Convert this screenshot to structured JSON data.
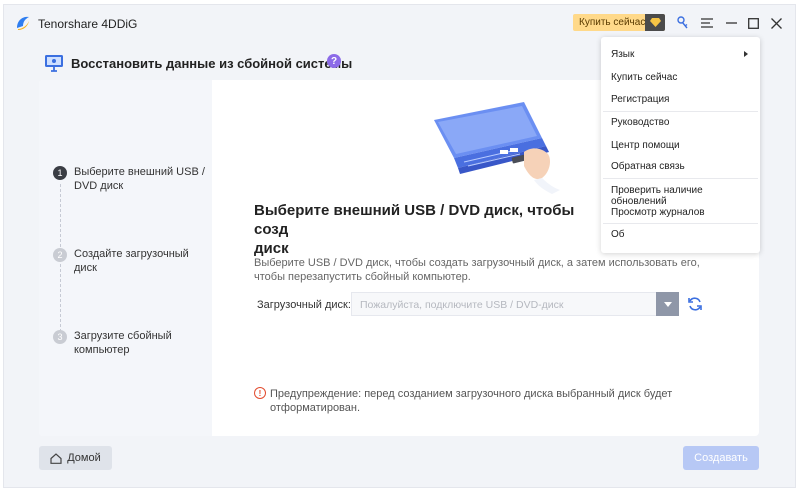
{
  "app": {
    "name": "Tenorshare 4DDiG",
    "buy_label": "Купить сейчас"
  },
  "heading": {
    "title": "Восстановить данные из сбойной системы",
    "help": "?"
  },
  "steps": [
    {
      "num": "1",
      "label": "Выберите внешний USB / DVD диск",
      "state": "active"
    },
    {
      "num": "2",
      "label": "Создайте загрузочный диск",
      "state": "inactive"
    },
    {
      "num": "3",
      "label": "Загрузите сбойный компьютер",
      "state": "inactive"
    }
  ],
  "main": {
    "title": "Выберите внешний USB / DVD диск, чтобы созд... диск",
    "title_visible": "Выберите внешний USB / DVD диск, чтобы созд",
    "title_line2": "диск",
    "description": "Выберите USB / DVD диск, чтобы создать загрузочный диск, а затем использовать его, чтобы перезапустить сбойный компьютер.",
    "disk_label": "Загрузочный диск:",
    "disk_placeholder": "Пожалуйста, подключите USB / DVD-диск",
    "warning": "Предупреждение: перед созданием загрузочного диска выбранный диск будет отформатирован."
  },
  "buttons": {
    "home": "Домой",
    "create": "Создавать"
  },
  "menu": {
    "items": [
      {
        "label": "Язык",
        "has_submenu": true
      },
      {
        "label": "Купить сейчас"
      },
      {
        "label": "Регистрация"
      },
      {
        "label": "Руководство"
      },
      {
        "label": "Центр помощи"
      },
      {
        "label": "Обратная связь"
      },
      {
        "label": "Проверить наличие обновлений"
      },
      {
        "label": "Просмотр журналов"
      },
      {
        "label": "Об"
      }
    ]
  },
  "colors": {
    "accent": "#3b6fe0",
    "buy_bg": "#ffd98a",
    "warning": "#e24b2e",
    "create_disabled": "#b7c8f5",
    "help_badge": "#8c6be8"
  }
}
